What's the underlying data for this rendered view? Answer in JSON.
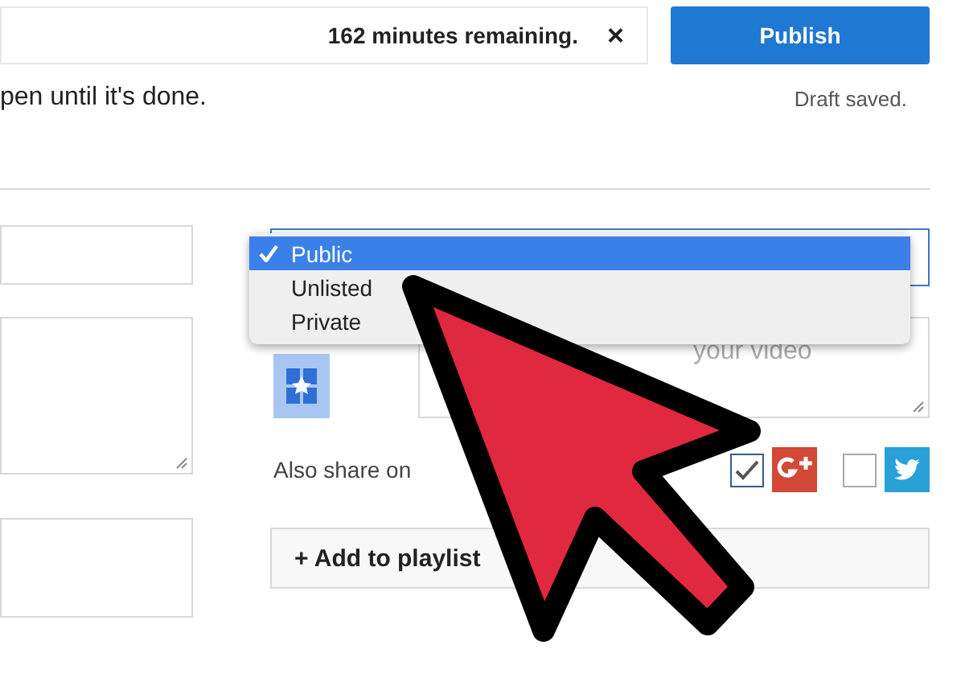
{
  "notice": {
    "text": "162 minutes remaining.",
    "close": "×"
  },
  "publish_button": "Publish",
  "message": "pen until it's done.",
  "draft_status": "Draft saved.",
  "visibility_options": [
    {
      "label": "Public",
      "selected": true
    },
    {
      "label": "Unlisted",
      "selected": false
    },
    {
      "label": "Private",
      "selected": false
    }
  ],
  "message_field": {
    "placeholder": "your video"
  },
  "share": {
    "label": "Also share on",
    "networks": [
      {
        "kind": "plus",
        "checked": true
      },
      {
        "kind": "bird",
        "checked": false
      }
    ]
  },
  "playlist_button": "+ Add to playlist"
}
